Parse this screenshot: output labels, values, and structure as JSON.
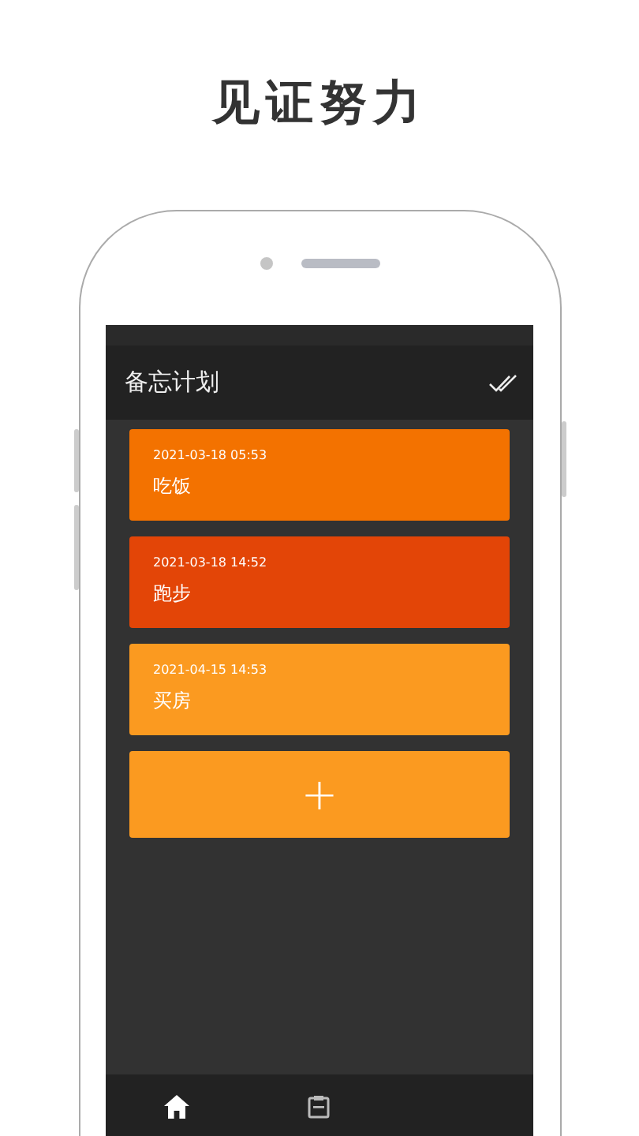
{
  "headline": "见证努力",
  "app_bar": {
    "title": "备忘计划"
  },
  "memos": [
    {
      "date": "2021-03-18 05:53",
      "title": "吃饭",
      "color": "#f37200"
    },
    {
      "date": "2021-03-18 14:52",
      "title": "跑步",
      "color": "#e34507"
    },
    {
      "date": "2021-04-15 14:53",
      "title": "买房",
      "color": "#fb9a20"
    }
  ],
  "add_button": {
    "label": "+",
    "color": "#fb9a20"
  }
}
